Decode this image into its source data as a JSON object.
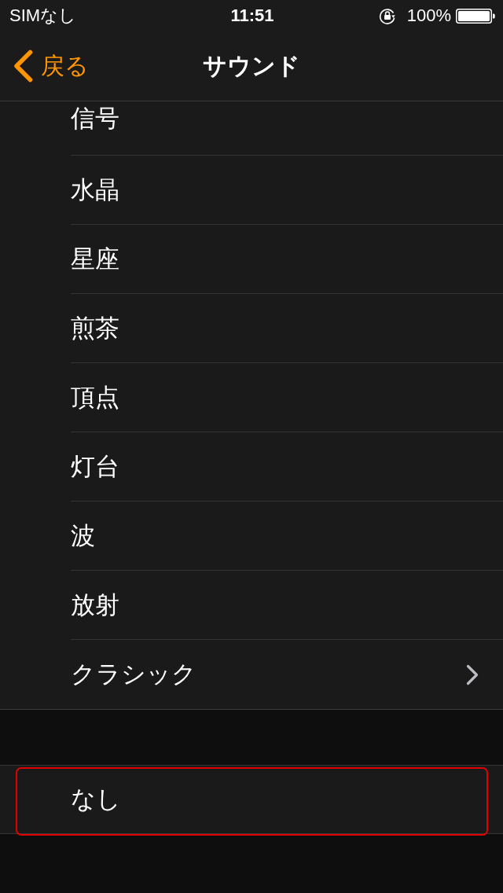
{
  "status_bar": {
    "carrier": "SIMなし",
    "time": "11:51",
    "battery": "100%"
  },
  "nav_bar": {
    "back": "戻る",
    "title": "サウンド"
  },
  "sounds": [
    {
      "label": "信号",
      "kind": "plain"
    },
    {
      "label": "水晶",
      "kind": "plain"
    },
    {
      "label": "星座",
      "kind": "plain"
    },
    {
      "label": "煎茶",
      "kind": "plain"
    },
    {
      "label": "頂点",
      "kind": "plain"
    },
    {
      "label": "灯台",
      "kind": "plain"
    },
    {
      "label": "波",
      "kind": "plain"
    },
    {
      "label": "放射",
      "kind": "plain"
    },
    {
      "label": "クラシック",
      "kind": "disclosure"
    }
  ],
  "none_section": {
    "items": [
      {
        "label": "なし",
        "highlighted": true
      }
    ]
  }
}
